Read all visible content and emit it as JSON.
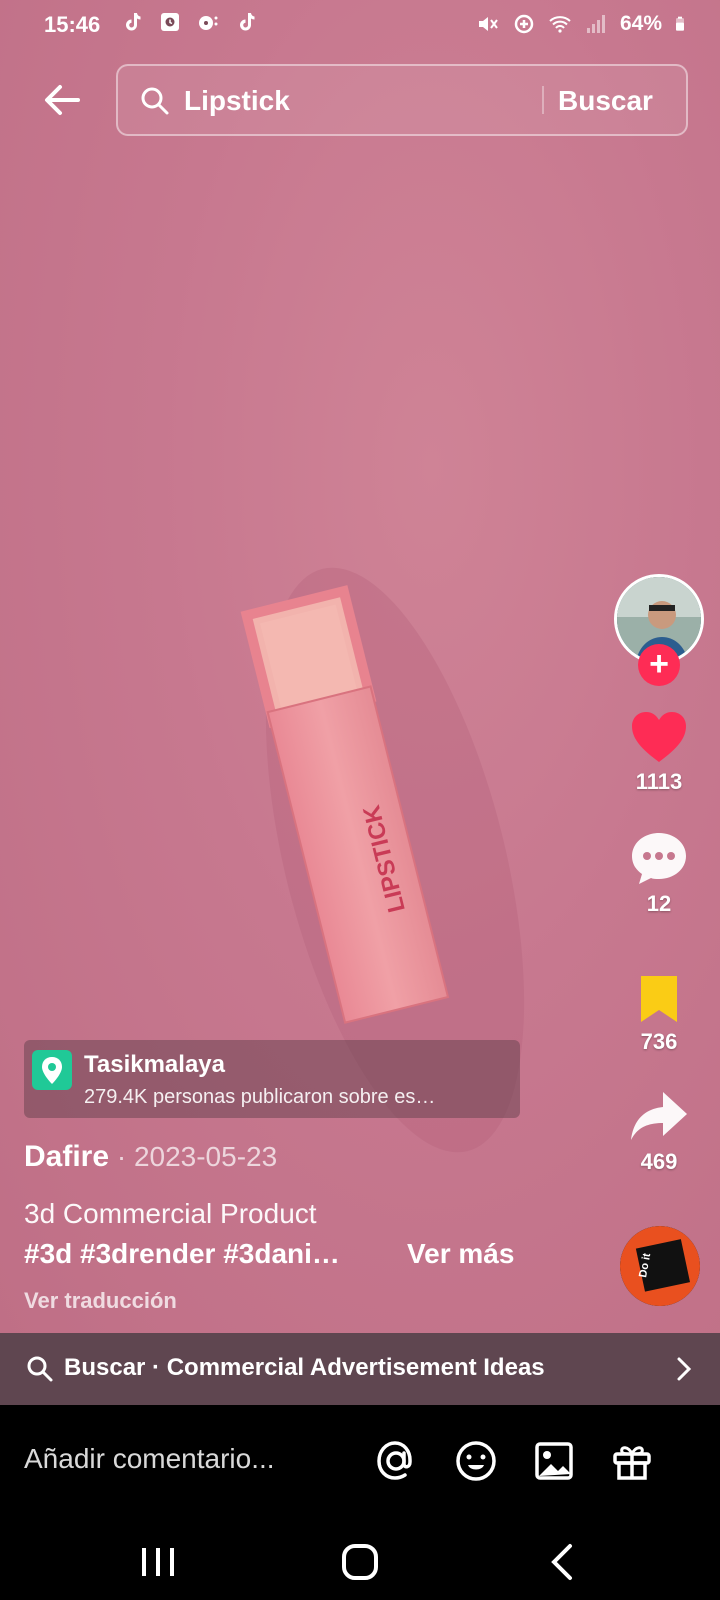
{
  "status": {
    "time": "15:46",
    "battery": "64%",
    "left_icons": [
      "tiktok-icon",
      "calendar-icon",
      "music-icon",
      "tiktok-icon"
    ],
    "right_icons": [
      "mute-icon",
      "data-saver-icon",
      "wifi-icon",
      "signal-icon",
      "battery-icon"
    ]
  },
  "header": {
    "search_query": "Lipstick",
    "search_button": "Buscar"
  },
  "product": {
    "box_label": "LIPSTICK"
  },
  "rail": {
    "likes": "1113",
    "comments": "12",
    "saves": "736",
    "shares": "469",
    "follow_symbol": "+",
    "disc_text": "Do it",
    "colors": {
      "like": "#fe2c55",
      "save": "#facc15",
      "follow": "#fe2c55"
    }
  },
  "location": {
    "name": "Tasikmalaya",
    "subtitle": "279.4K personas publicaron sobre es…"
  },
  "post": {
    "author": "Dafire",
    "separator": " · ",
    "date": "2023-05-23",
    "caption": "3d Commercial Product",
    "hashtags": "#3d #3drender #3dani…",
    "more": "Ver más",
    "translate": "Ver traducción"
  },
  "suggestion": {
    "text": "Buscar · Commercial Advertisement Ideas"
  },
  "comment": {
    "placeholder": "Añadir comentario..."
  },
  "icons": {
    "mention": "at-icon",
    "emoji": "emoji-icon",
    "image": "image-icon",
    "gift": "gift-icon"
  }
}
